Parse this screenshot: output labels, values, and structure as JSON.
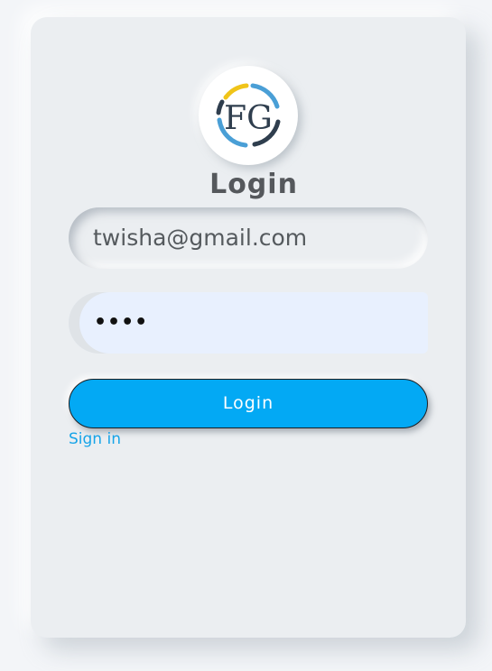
{
  "logo": {
    "text": "FG",
    "icon": "fg-logo-icon",
    "colors": [
      "#f0c419",
      "#4a9fd6",
      "#2f3e4e"
    ]
  },
  "form": {
    "title": "Login",
    "email_value": "twisha@gmail.com",
    "password_value": "••••",
    "submit_label": "Login",
    "signin_link": "Sign in"
  },
  "colors": {
    "accent": "#03a9f4",
    "link": "#17a4e8",
    "card_bg": "#ebeef1",
    "autofill_bg": "#e8f0fe"
  }
}
